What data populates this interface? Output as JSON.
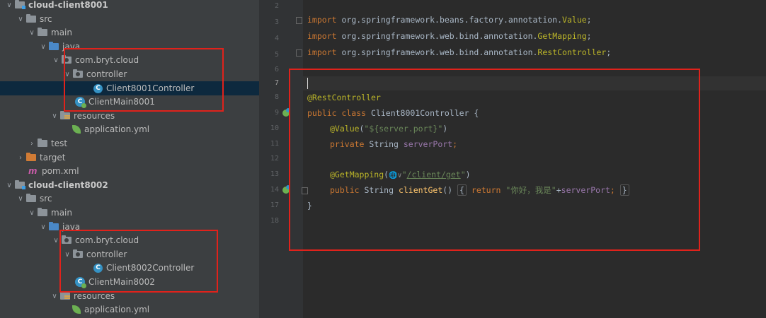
{
  "project_tree": {
    "rows": [
      {
        "label": "cloud-client8001",
        "icon": "module-folder-icon",
        "arrow": "down"
      },
      {
        "label": "src",
        "icon": "folder-icon",
        "arrow": "down"
      },
      {
        "label": "main",
        "icon": "folder-icon",
        "arrow": "down"
      },
      {
        "label": "java",
        "icon": "source-folder-icon",
        "arrow": "down"
      },
      {
        "label": "com.bryt.cloud",
        "icon": "package-icon",
        "arrow": "down"
      },
      {
        "label": "controller",
        "icon": "package-icon",
        "arrow": "down"
      },
      {
        "label": "Client8001Controller",
        "icon": "class-icon",
        "arrow": "none",
        "selected": true
      },
      {
        "label": "ClientMain8001",
        "icon": "spring-boot-class-icon",
        "arrow": "none"
      },
      {
        "label": "resources",
        "icon": "resources-folder-icon",
        "arrow": "down"
      },
      {
        "label": "application.yml",
        "icon": "spring-config-icon",
        "arrow": "none"
      },
      {
        "label": "test",
        "icon": "folder-icon",
        "arrow": "right"
      },
      {
        "label": "target",
        "icon": "target-folder-icon",
        "arrow": "right"
      },
      {
        "label": "pom.xml",
        "icon": "maven-icon",
        "arrow": "none"
      },
      {
        "label": "cloud-client8002",
        "icon": "module-folder-icon",
        "arrow": "down"
      },
      {
        "label": "src",
        "icon": "folder-icon",
        "arrow": "down"
      },
      {
        "label": "main",
        "icon": "folder-icon",
        "arrow": "down"
      },
      {
        "label": "java",
        "icon": "source-folder-icon",
        "arrow": "down"
      },
      {
        "label": "com.bryt.cloud",
        "icon": "package-icon",
        "arrow": "down"
      },
      {
        "label": "controller",
        "icon": "package-icon",
        "arrow": "down"
      },
      {
        "label": "Client8002Controller",
        "icon": "class-icon",
        "arrow": "none"
      },
      {
        "label": "ClientMain8002",
        "icon": "spring-boot-class-icon",
        "arrow": "none"
      },
      {
        "label": "resources",
        "icon": "resources-folder-icon",
        "arrow": "down"
      },
      {
        "label": "application.yml",
        "icon": "spring-config-icon",
        "arrow": "none"
      }
    ]
  },
  "editor": {
    "line_numbers": [
      "2",
      "3",
      "4",
      "5",
      "6",
      "7",
      "8",
      "9",
      "10",
      "11",
      "12",
      "13",
      "14",
      "17",
      "18"
    ],
    "current_line": "7",
    "code": {
      "l3_kw": "import",
      "l3_pkg": " org.springframework.beans.factory.annotation.",
      "l3_cls": "Value",
      "l4_kw": "import",
      "l4_pkg": " org.springframework.web.bind.annotation.",
      "l4_cls": "GetMapping",
      "l5_kw": "import",
      "l5_pkg": " org.springframework.web.bind.annotation.",
      "l5_cls": "RestController",
      "l8_ann": "@RestController",
      "l9_kw": "public class ",
      "l9_name": "Client8001Controller {",
      "l10_ann": "@Value",
      "l10_open": "(",
      "l10_str": "\"${server.port}\"",
      "l10_close": ")",
      "l11_kw": "private ",
      "l11_type": "String ",
      "l11_fld": "serverPort",
      "l11_end": ";",
      "l13_ann": "@GetMapping",
      "l13_open": "(",
      "l13_globe": "🌐∨",
      "l13_str_q1": "\"",
      "l13_str_path": "/client/get",
      "l13_str_q2": "\"",
      "l13_close": ")",
      "l14_kw": "public ",
      "l14_type": "String ",
      "l14_fn": "clientGet",
      "l14_paren": "() ",
      "l14_brace_open": "{",
      "l14_ret": " return ",
      "l14_str": "\"你好，我是\"",
      "l14_plus": "+",
      "l14_fld": "serverPort",
      "l14_semi": "; ",
      "l14_brace_close": "}",
      "l17_brace": "}"
    }
  },
  "colors": {
    "highlight_box": "#e0221b",
    "selection": "#0d293e",
    "keyword": "#cc7832",
    "annotation": "#bbb529",
    "string": "#6a8759",
    "field": "#9876aa",
    "method": "#ffc66d"
  }
}
